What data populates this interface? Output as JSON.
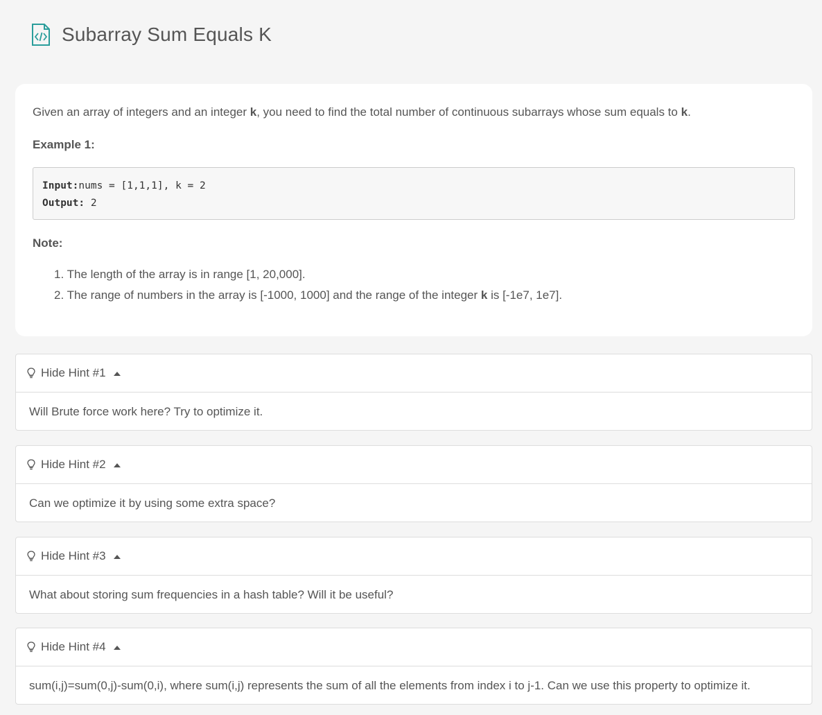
{
  "page": {
    "title": "Subarray Sum Equals K",
    "icon": "code-file-icon",
    "accent_color": "#2a9d9b"
  },
  "problem": {
    "description_prefix": "Given an array of integers and an integer ",
    "description_k": "k",
    "description_middle": ", you need to find the total number of continuous subarrays whose sum equals to ",
    "description_k2": "k",
    "description_suffix": ".",
    "example_heading": "Example 1:",
    "example_input_label": "Input:",
    "example_input_value": "nums = [1,1,1], k = 2",
    "example_output_label": "Output:",
    "example_output_value": " 2",
    "note_heading": "Note:",
    "note_items": [
      {
        "number": "1.",
        "text": "The length of the array is in range [1, 20,000]."
      },
      {
        "number": "2.",
        "text_prefix": "The range of numbers in the array is [-1000, 1000] and the range of the integer ",
        "text_bold": "k",
        "text_suffix": " is [-1e7, 1e7]."
      }
    ]
  },
  "hints": [
    {
      "label": "Hide Hint #1",
      "text": "Will Brute force work here? Try to optimize it."
    },
    {
      "label": "Hide Hint #2",
      "text": "Can we optimize it by using some extra space?"
    },
    {
      "label": "Hide Hint #3",
      "text": "What about storing sum frequencies in a hash table? Will it be useful?"
    },
    {
      "label": "Hide Hint #4",
      "text": "sum(i,j)=sum(0,j)-sum(0,i), where sum(i,j) represents the sum of all the elements from index i to j-1. Can we use this property to optimize it."
    }
  ]
}
